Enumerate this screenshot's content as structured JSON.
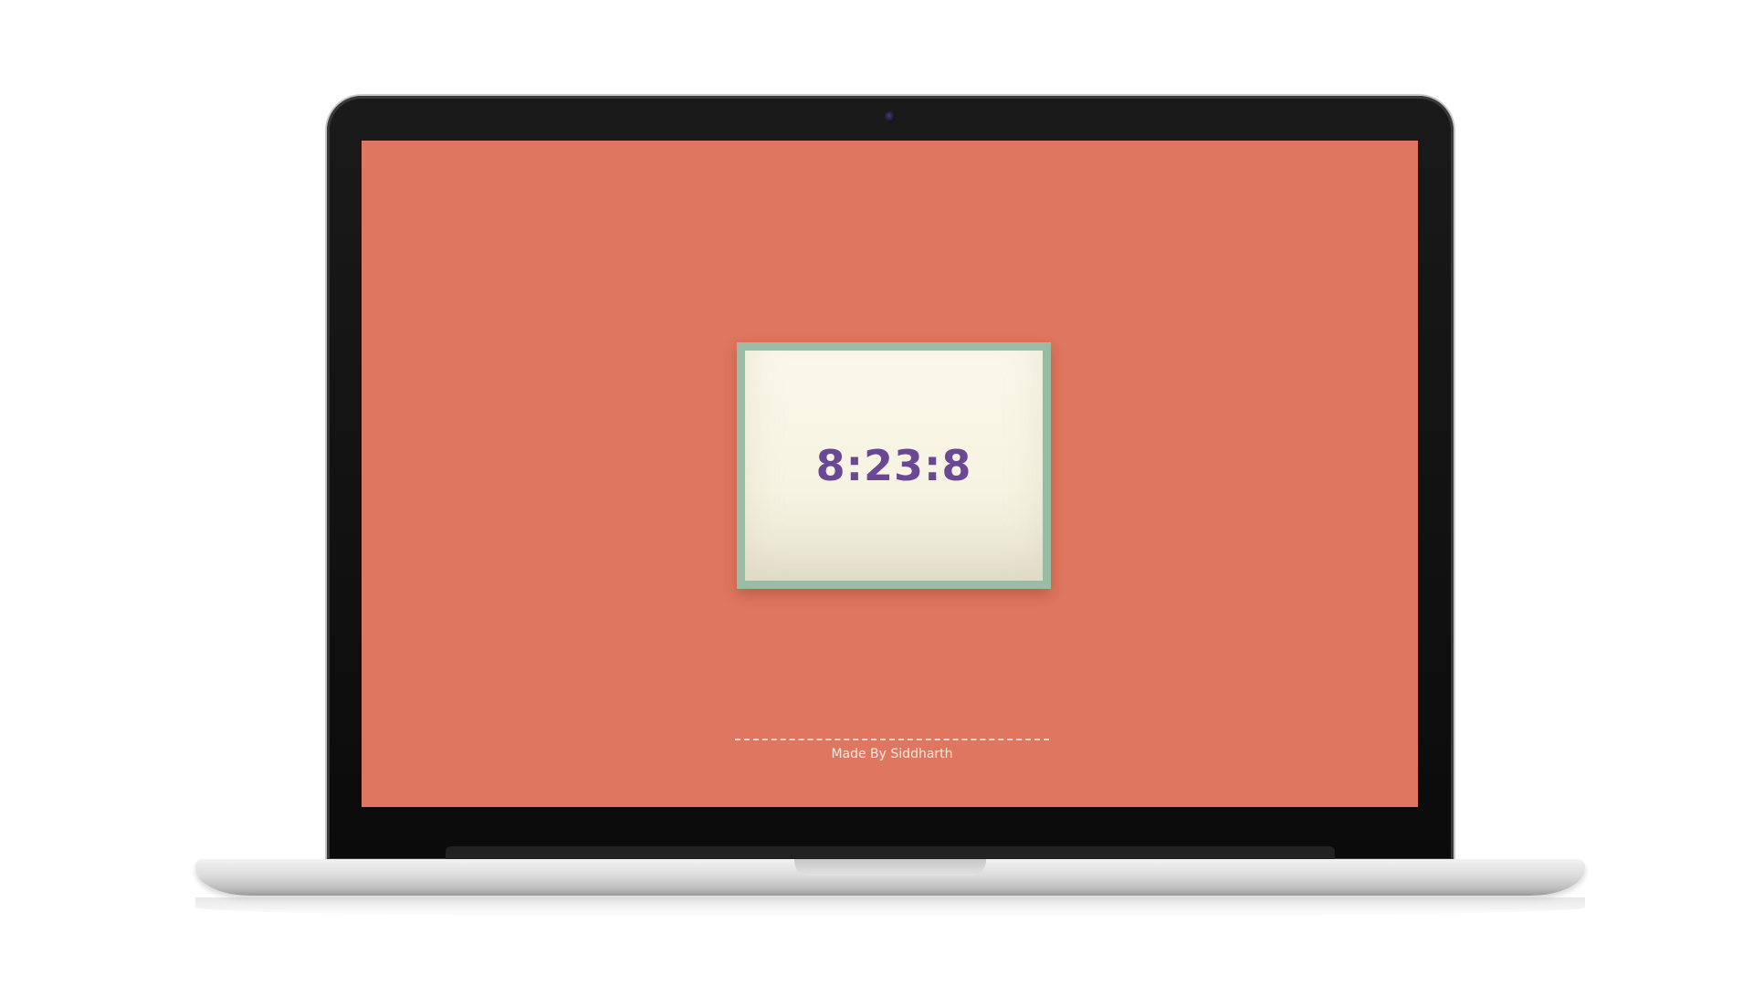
{
  "clock": {
    "time": "8:23:8"
  },
  "footer": {
    "credit": "Made By Siddharth"
  },
  "colors": {
    "screen_background": "#df765f",
    "card_background": "#fbf8ea",
    "card_border": "#98bca4",
    "clock_text": "#6b4894",
    "footer_text": "#fbe9e2"
  },
  "icons": {
    "camera": "webcam-icon"
  }
}
